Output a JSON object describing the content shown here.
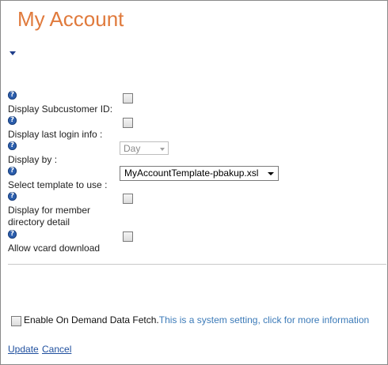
{
  "page": {
    "title": "My Account"
  },
  "settings": [
    {
      "label": "Display Subcustomer ID:",
      "control": "checkbox",
      "checked": false
    },
    {
      "label": "Display last login info :",
      "control": "checkbox",
      "checked": false
    },
    {
      "label": "Display by :",
      "control": "select",
      "value": "Day",
      "disabled": true
    },
    {
      "label": "Select template to use :",
      "control": "select",
      "value": "MyAccountTemplate-pbakup.xsl",
      "disabled": false
    },
    {
      "label_line1": "Display for member",
      "label_line2": "directory detail",
      "control": "checkbox",
      "checked": false
    },
    {
      "label": "Allow vcard download",
      "control": "checkbox",
      "checked": false
    }
  ],
  "help_icon": "question-mark-help-icon",
  "on_demand": {
    "label": "Enable On Demand Data Fetch.",
    "link_text": "This is a system setting, click for more information",
    "checked": false
  },
  "footer": {
    "update_label": "Update",
    "cancel_label": "Cancel"
  },
  "colors": {
    "title": "#e07a3c",
    "help_icon": "#2c5fae",
    "link": "#1f4f9e",
    "info_link": "#3b7ab8"
  }
}
